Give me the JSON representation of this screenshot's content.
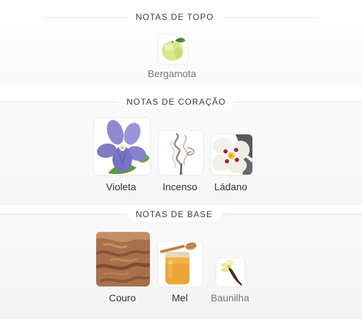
{
  "sections": [
    {
      "title": "NOTAS DE TOPO",
      "notes": [
        {
          "name": "Bergamota",
          "icon": "bergamot-icon"
        }
      ]
    },
    {
      "title": "NOTAS DE CORAÇÃO",
      "notes": [
        {
          "name": "Violeta",
          "icon": "violet-flower-icon"
        },
        {
          "name": "Incenso",
          "icon": "incense-smoke-icon"
        },
        {
          "name": "Ládano",
          "icon": "labdanum-flower-icon"
        }
      ]
    },
    {
      "title": "NOTAS DE BASE",
      "notes": [
        {
          "name": "Couro",
          "icon": "leather-icon"
        },
        {
          "name": "Mel",
          "icon": "honey-jar-icon"
        },
        {
          "name": "Baunilha",
          "icon": "vanilla-icon"
        }
      ]
    }
  ]
}
